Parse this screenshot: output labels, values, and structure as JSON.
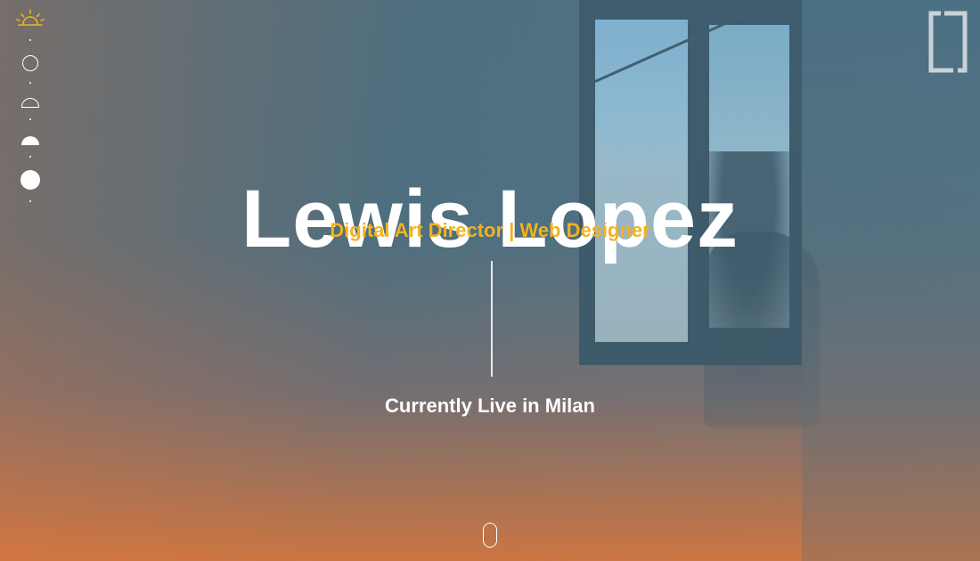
{
  "hero": {
    "name": "Lewis Lopez",
    "subtitle": "Digital Art Director | Web Designer",
    "location": "Currently Live in Milan"
  },
  "nav": {
    "phases": [
      "sunrise-icon",
      "circle-outline-icon",
      "half-circle-outline-icon",
      "half-circle-filled-icon",
      "full-circle-filled-icon"
    ]
  },
  "colors": {
    "accent": "#f2b21e",
    "text": "#ffffff",
    "bg_top": "#4f6f80",
    "bg_bottom": "#d8743a"
  },
  "icons": {
    "logo": "bracket-logo-icon",
    "scroll": "mouse-scroll-icon"
  }
}
